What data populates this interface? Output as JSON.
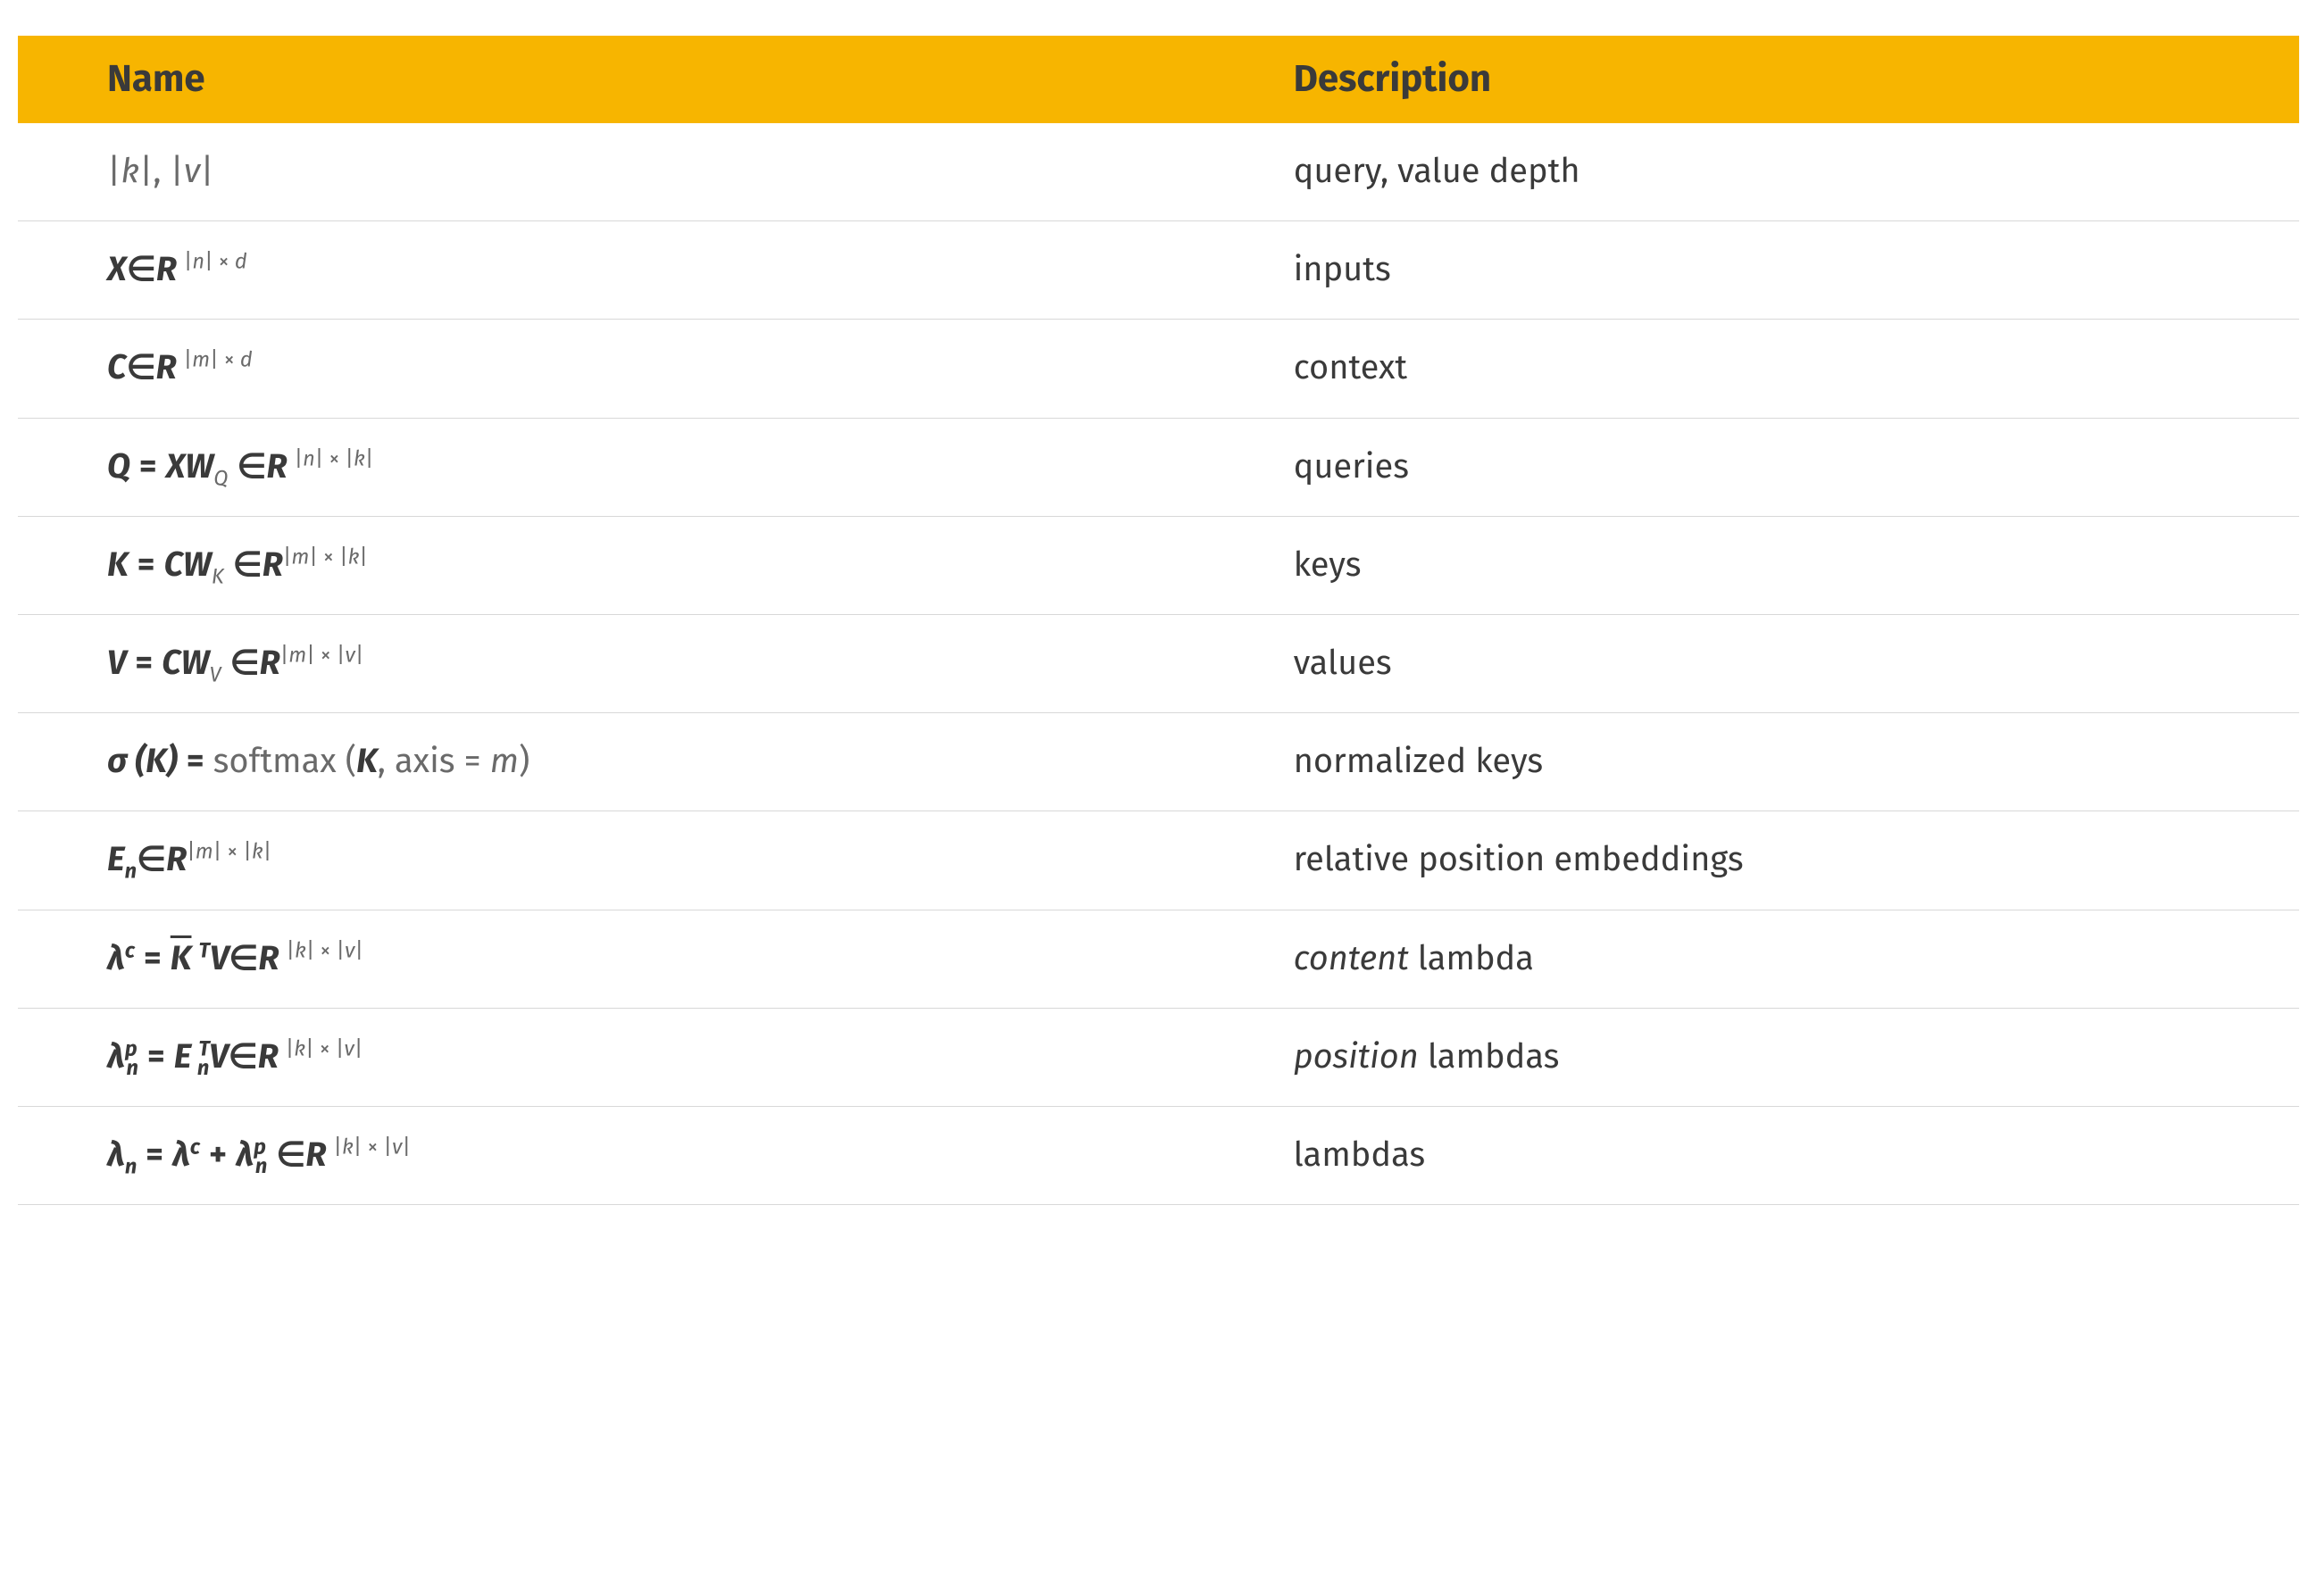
{
  "header": {
    "name": "Name",
    "description": "Description"
  },
  "rows": [
    {
      "formula_html": "<span class='lighter'>|<span class='ital'>k</span>|, |<span class='ital'>v</span>|</span>",
      "description_html": "query, value depth"
    },
    {
      "formula_html": "<span class='bold ital'>X</span><span class='bold'>∈</span><span class='bold ital'>R</span><span class='gap'></span><sup class='lighter'>|<span class='ital'>n</span>| × <span class='ital'>d</span></sup>",
      "description_html": "inputs"
    },
    {
      "formula_html": "<span class='bold ital'>C</span><span class='bold'>∈</span><span class='bold ital'>R</span><span class='gap'></span><sup class='lighter'>|<span class='ital'>m</span>| × <span class='ital'>d</span></sup>",
      "description_html": "context"
    },
    {
      "formula_html": "<span class='bold ital'>Q</span> <span class='bold'>=</span> <span class='bold ital'>XW</span><sub class='ital lighter'>Q</sub> <span class='bold'>∈</span><span class='bold ital'>R</span><span class='gap'></span><sup class='lighter'>|<span class='ital'>n</span>| × |<span class='ital'>k</span>|</sup>",
      "description_html": "queries"
    },
    {
      "formula_html": "<span class='bold ital'>K</span> <span class='bold'>=</span> <span class='bold ital'>CW</span><sub class='ital lighter'>K</sub> <span class='bold'>∈</span><span class='bold ital'>R</span><sup class='lighter'>|<span class='ital'>m</span>| × |<span class='ital'>k</span>|</sup>",
      "description_html": "keys"
    },
    {
      "formula_html": "<span class='bold ital'>V</span> <span class='bold'>=</span> <span class='bold ital'>CW</span><sub class='ital lighter'>V</sub> <span class='bold'>∈</span><span class='bold ital'>R</span><sup class='lighter'>|<span class='ital'>m</span>| × |<span class='ital'>v</span>|</sup>",
      "description_html": "values"
    },
    {
      "formula_html": "<span class='bold ital'>σ (K)</span> <span class='bold'>=</span> <span class='lighter'>softmax (</span><span class='bold ital'>K</span><span class='lighter'>, axis = <span class='ital'>m</span>)</span>",
      "description_html": "normalized keys"
    },
    {
      "formula_html": "<span class='bold ital'>E<sub>n</sub></span><span class='bold'>∈</span><span class='bold ital'>R</span><sup class='lighter'>|<span class='ital'>m</span>| × |<span class='ital'>k</span>|</sup>",
      "description_html": "relative position embeddings"
    },
    {
      "formula_html": "<span class='bold ital'>λ<sup>c</sup></span> <span class='bold'>=</span> <span class='bold ital overbar'>K</span><span class='gap'></span><sup class='bold ital'>T</sup><span class='bold ital'>V</span><span class='bold'>∈</span><span class='bold ital'>R</span><span class='gap'></span><sup class='lighter'>|<span class='ital'>k</span>| × |<span class='ital'>v</span>|</sup>",
      "description_html": "<span class='ital'>content</span> lambda"
    },
    {
      "formula_html": "<span class='bold ital'>λ<sup>p</sup><sub style='margin-left:-12px'>n</sub></span> <span class='bold'>=</span> <span class='bold ital'>E</span><span class='gap'></span><sup class='bold ital'>T</sup><sub class='bold ital' style='margin-left:-14px'>n</sub><span class='bold ital'>V</span><span class='bold'>∈</span><span class='bold ital'>R</span><span class='gap'></span><sup class='lighter'>|<span class='ital'>k</span>| × |<span class='ital'>v</span>|</sup>",
      "description_html": "<span class='ital'>position</span> lambdas"
    },
    {
      "formula_html": "<span class='bold ital'>λ<sub>n</sub></span> <span class='bold'>=</span> <span class='bold ital'>λ<sup>c</sup></span> <span class='bold'>+</span> <span class='bold ital'>λ<sup>p</sup><sub style='margin-left:-12px'>n</sub></span> <span class='bold'>∈</span><span class='bold ital'>R</span><span class='gap'></span><sup class='lighter'>|<span class='ital'>k</span>| × |<span class='ital'>v</span>|</sup>",
      "description_html": "lambdas"
    }
  ]
}
